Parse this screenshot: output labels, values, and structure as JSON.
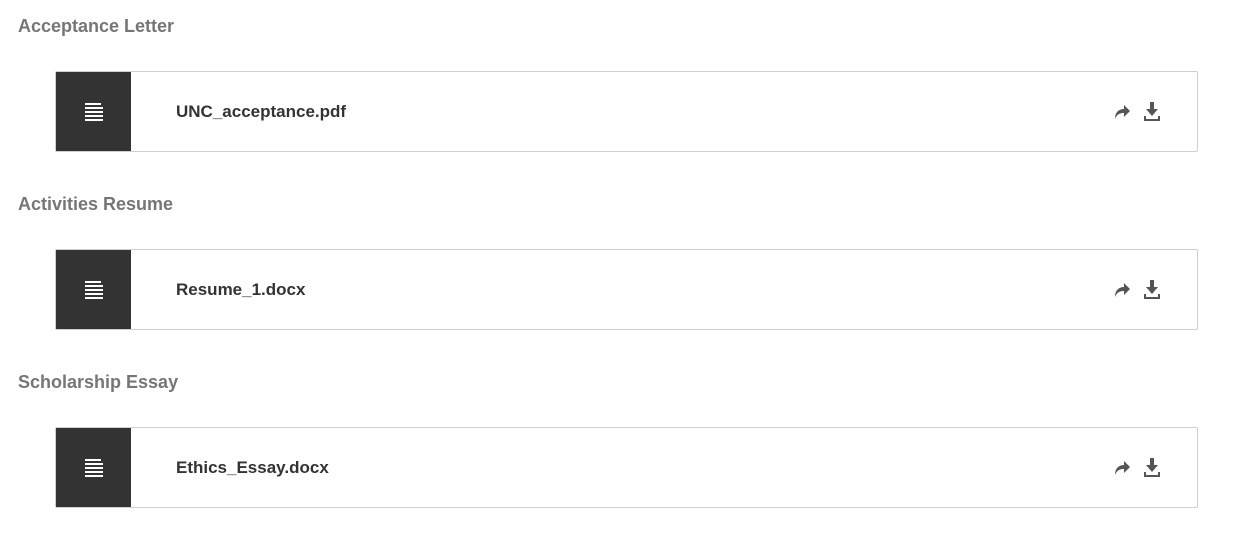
{
  "colors": {
    "section_title": "#767676",
    "file_name": "#333333",
    "file_type_box": "#333333",
    "card_border": "#cfcfcf",
    "icon": "#555555"
  },
  "sections": [
    {
      "title": "Acceptance Letter",
      "file": {
        "name": "UNC_acceptance.pdf",
        "type_icon": "document-lines-icon",
        "actions": [
          "share-icon",
          "download-icon"
        ]
      }
    },
    {
      "title": "Activities Resume",
      "file": {
        "name": "Resume_1.docx",
        "type_icon": "document-lines-icon",
        "actions": [
          "share-icon",
          "download-icon"
        ]
      }
    },
    {
      "title": "Scholarship Essay",
      "file": {
        "name": "Ethics_Essay.docx",
        "type_icon": "document-lines-icon",
        "actions": [
          "share-icon",
          "download-icon"
        ]
      }
    }
  ]
}
